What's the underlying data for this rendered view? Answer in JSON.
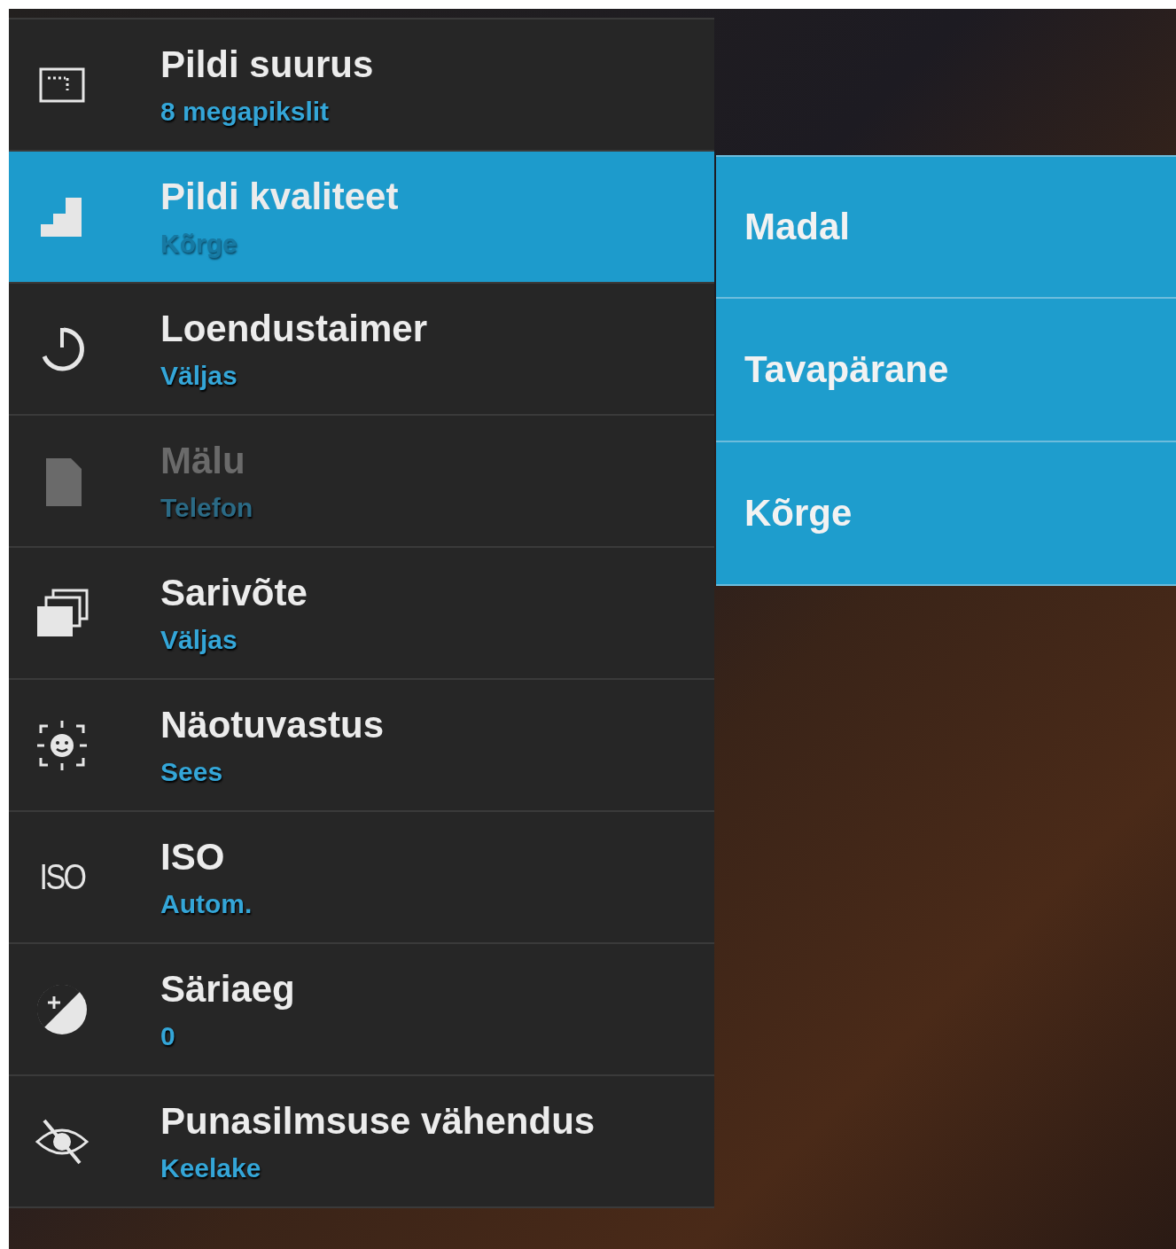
{
  "settings": [
    {
      "kind": "size",
      "title": "Pildi suurus",
      "value": "8 megapikslit",
      "selected": false,
      "disabled": false
    },
    {
      "kind": "quality",
      "title": "Pildi kvaliteet",
      "value": "Kõrge",
      "selected": true,
      "disabled": false
    },
    {
      "kind": "timer",
      "title": "Loendustaimer",
      "value": "Väljas",
      "selected": false,
      "disabled": false
    },
    {
      "kind": "storage",
      "title": "Mälu",
      "value": "Telefon",
      "selected": false,
      "disabled": true
    },
    {
      "kind": "burst",
      "title": "Sarivõte",
      "value": "Väljas",
      "selected": false,
      "disabled": false
    },
    {
      "kind": "face",
      "title": "Näotuvastus",
      "value": "Sees",
      "selected": false,
      "disabled": false
    },
    {
      "kind": "iso",
      "icon_text": "ISO",
      "title": "ISO",
      "value": "Autom.",
      "selected": false,
      "disabled": false
    },
    {
      "kind": "exposure",
      "title": "Säriaeg",
      "value": "0",
      "selected": false,
      "disabled": false
    },
    {
      "kind": "redeye",
      "title": "Punasilmsuse vähendus",
      "value": "Keelake",
      "selected": false,
      "disabled": false
    }
  ],
  "options": [
    "Madal",
    "Tavapärane",
    "Kõrge"
  ]
}
